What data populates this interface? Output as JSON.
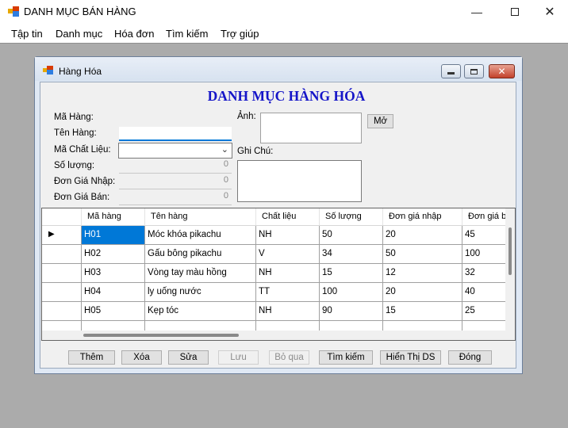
{
  "window": {
    "title": "DANH MỤC BÁN HÀNG",
    "minimize_icon": "minimize-icon",
    "maximize_icon": "maximize-icon",
    "close_icon": "close-icon"
  },
  "menu": [
    "Tập tin",
    "Danh mục",
    "Hóa đơn",
    "Tìm kiếm",
    "Trợ giúp"
  ],
  "child": {
    "title": "Hàng Hóa",
    "heading": "DANH MỤC HÀNG HÓA",
    "heading_color": "#1515c8"
  },
  "form": {
    "labels": {
      "ma_hang": "Mã Hàng:",
      "ten_hang": "Tên Hàng:",
      "ma_chat_lieu": "Mã Chất Liệu:",
      "so_luong": "Số lượng:",
      "don_gia_nhap": "Đơn Giá Nhập:",
      "don_gia_ban": "Đơn Giá Bán:",
      "anh": "Ảnh:",
      "ghi_chu": "Ghi Chú:"
    },
    "values": {
      "ma_hang": "",
      "ten_hang": "",
      "ma_chat_lieu": "",
      "so_luong": "0",
      "don_gia_nhap": "0",
      "don_gia_ban": "0"
    },
    "mo_button": "Mở"
  },
  "grid": {
    "columns": [
      "Mã hàng",
      "Tên hàng",
      "Chất liệu",
      "Số lượng",
      "Đơn giá nhập",
      "Đơn giá b"
    ],
    "rows": [
      [
        "H01",
        "Móc khóa pikachu",
        "NH",
        "50",
        "20",
        "45"
      ],
      [
        "H02",
        "Gấu bông pikachu",
        "V",
        "34",
        "50",
        "100"
      ],
      [
        "H03",
        "Vòng tay màu hồng",
        "NH",
        "15",
        "12",
        "32"
      ],
      [
        "H04",
        "ly uống nước",
        "TT",
        "100",
        "20",
        "40"
      ],
      [
        "H05",
        "Kẹp tóc",
        "NH",
        "90",
        "15",
        "25"
      ]
    ],
    "selected_row": 0,
    "selection_color": "#0078d7"
  },
  "buttons": {
    "them": "Thêm",
    "xoa": "Xóa",
    "sua": "Sửa",
    "luu": "Lưu",
    "bo_qua": "Bỏ qua",
    "tim_kiem": "Tìm kiếm",
    "hien_thi_ds": "Hiển Thị DS",
    "dong": "Đóng"
  }
}
